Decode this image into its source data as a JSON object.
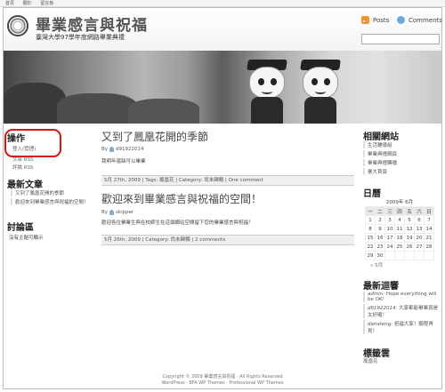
{
  "topbar": {
    "items": [
      "首頁",
      "關於",
      "留言板"
    ]
  },
  "header": {
    "title": "畢業感言與祝福",
    "tagline": "臺灣大學97學年度網路畢業典禮",
    "posts_label": "Posts",
    "comments_label": "Comments"
  },
  "left": {
    "ops_title": "操作",
    "login": "登入(管理)",
    "entries_rss": "文章 RSS",
    "comments_rss": "評論 RSS",
    "recent_title": "最新文章",
    "recent": [
      "又到了鳳凰花開的季節",
      "歡迎來到畢業感言與祝福的空間！"
    ],
    "discuss_title": "討論區",
    "discuss_empty": "沒有主題可顯示"
  },
  "posts": [
    {
      "title": "又到了鳳凰花開的季節",
      "by": "By",
      "author": "d91922014",
      "excerpt": "我明年還缺可以畢業",
      "date": "5月 27th, 2009",
      "tags_label": "Tags:",
      "tag": "鳳凰花",
      "category_label": "Category:",
      "category": "尚未歸類",
      "comments": "One comment"
    },
    {
      "title": "歡迎來到畢業感言與祝福的空間！",
      "by": "By",
      "author": "skipper",
      "excerpt": "歡迎各位畢業生與在校師生在這個網站空間留下您的畢業感言與祝福！",
      "date": "5月 26th, 2009",
      "category_label": "Category:",
      "category": "尚未歸類",
      "comments": "2 comments"
    }
  ],
  "right": {
    "links_title": "相關網站",
    "links": [
      "生活輔導組",
      "畢業典禮網頁",
      "畢業典禮轉播",
      "臺大首頁"
    ],
    "calendar_title": "日曆",
    "calendar": {
      "caption": "2009年 6月",
      "headers": [
        "一",
        "二",
        "三",
        "四",
        "五",
        "六",
        "日"
      ],
      "rows": [
        [
          "1",
          "2",
          "3",
          "4",
          "5",
          "6",
          "7"
        ],
        [
          "8",
          "9",
          "10",
          "11",
          "12",
          "13",
          "14"
        ],
        [
          "15",
          "16",
          "17",
          "18",
          "19",
          "20",
          "21"
        ],
        [
          "22",
          "23",
          "24",
          "25",
          "26",
          "27",
          "28"
        ],
        [
          "29",
          "30",
          "",
          "",
          "",
          "",
          ""
        ]
      ],
      "prev": "« 5月"
    },
    "echo_title": "最新迴響",
    "echoes": [
      {
        "who": "admin:",
        "text": "Hope everything will be OK!"
      },
      {
        "who": "d91922014:",
        "text": "大家都能畢業真是太好囉！"
      },
      {
        "who": "danateng:",
        "text": "祝福大家！願程再見！"
      }
    ],
    "tags_title": "標籤雲",
    "tag": "鳳凰花"
  },
  "footer": {
    "copyright": "Copyright © 2009 畢業感言與祝福 · All Rights Reserved",
    "credits": "WordPress · BFA WP Themes · Professional WP Themes"
  },
  "colors": {
    "highlight": "#dd1111",
    "accent": "#8aa7c8"
  }
}
